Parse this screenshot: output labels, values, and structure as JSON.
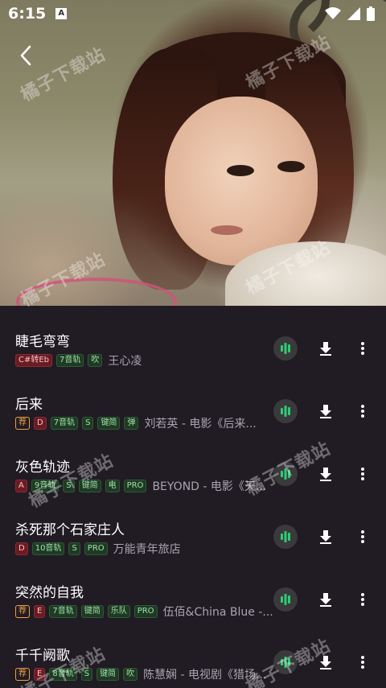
{
  "status": {
    "time": "6:15",
    "notification_letter": "A"
  },
  "watermark": "橘子下载站",
  "songs": [
    {
      "title": "睫毛弯弯",
      "tags": [
        {
          "text": "C#转Eb",
          "style": "red"
        },
        {
          "text": "7音轨",
          "style": "green"
        },
        {
          "text": "吹",
          "style": "green"
        }
      ],
      "artist": "王心凌"
    },
    {
      "title": "后来",
      "tags": [
        {
          "text": "荐",
          "style": "orange"
        },
        {
          "text": "D",
          "style": "red"
        },
        {
          "text": "7音轨",
          "style": "green"
        },
        {
          "text": "S",
          "style": "green"
        },
        {
          "text": "键简",
          "style": "green"
        },
        {
          "text": "弹",
          "style": "green"
        }
      ],
      "artist": "刘若英 - 电影《后来..."
    },
    {
      "title": "灰色轨迹",
      "tags": [
        {
          "text": "A",
          "style": "red"
        },
        {
          "text": "9音轨",
          "style": "green"
        },
        {
          "text": "S",
          "style": "green"
        },
        {
          "text": "键简",
          "style": "green"
        },
        {
          "text": "电",
          "style": "green"
        },
        {
          "text": "PRO",
          "style": "green"
        }
      ],
      "artist": "BEYOND - 电影《天..."
    },
    {
      "title": "杀死那个石家庄人",
      "tags": [
        {
          "text": "D",
          "style": "red"
        },
        {
          "text": "10音轨",
          "style": "green"
        },
        {
          "text": "S",
          "style": "green"
        },
        {
          "text": "PRO",
          "style": "green"
        }
      ],
      "artist": "万能青年旅店"
    },
    {
      "title": "突然的自我",
      "tags": [
        {
          "text": "荐",
          "style": "orange"
        },
        {
          "text": "E",
          "style": "red"
        },
        {
          "text": "7音轨",
          "style": "green"
        },
        {
          "text": "键简",
          "style": "green"
        },
        {
          "text": "乐队",
          "style": "green"
        },
        {
          "text": "PRO",
          "style": "green"
        }
      ],
      "artist": "伍佰&China Blue -..."
    },
    {
      "title": "千千阙歌",
      "tags": [
        {
          "text": "荐",
          "style": "orange"
        },
        {
          "text": "E",
          "style": "red"
        },
        {
          "text": "8音轨",
          "style": "green"
        },
        {
          "text": "S",
          "style": "green"
        },
        {
          "text": "键简",
          "style": "green"
        },
        {
          "text": "吹",
          "style": "green"
        }
      ],
      "artist": "陈慧娴 - 电视剧《猎场..."
    }
  ],
  "icons": {
    "back": "chevron-left-icon",
    "play": "audio-wave-icon",
    "download": "download-icon",
    "more": "more-vertical-icon"
  },
  "colors": {
    "accent": "#2ecc71",
    "list_bg": "#211b24"
  }
}
